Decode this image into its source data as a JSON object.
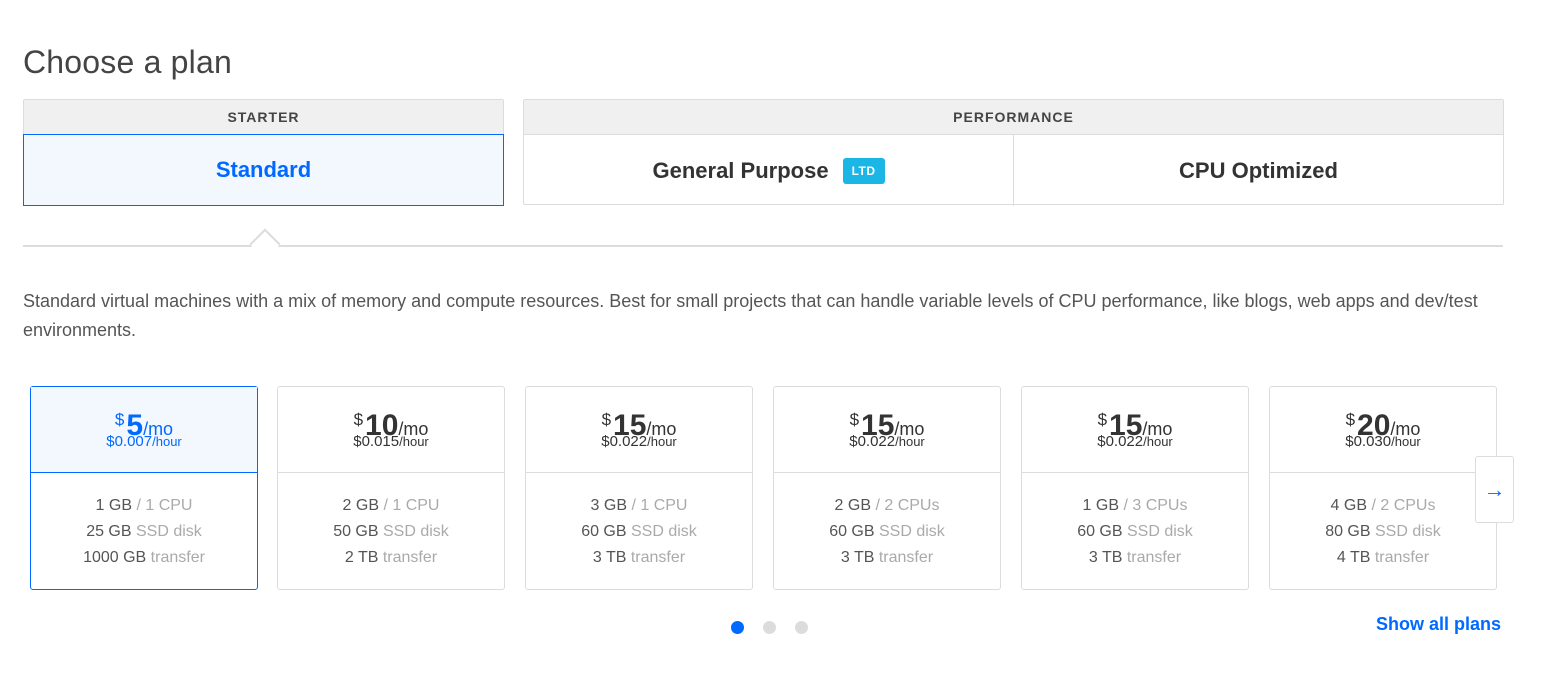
{
  "page_title": "Choose a plan",
  "categories": {
    "starter": {
      "header": "STARTER",
      "tabs": [
        {
          "label": "Standard",
          "selected": true
        }
      ]
    },
    "performance": {
      "header": "PERFORMANCE",
      "tabs": [
        {
          "label": "General Purpose",
          "badge": "LTD",
          "selected": false
        },
        {
          "label": "CPU Optimized",
          "selected": false
        }
      ]
    }
  },
  "description": "Standard virtual machines with a mix of memory and compute resources. Best for small projects that can handle variable levels of CPU performance, like blogs, web apps and dev/test environments.",
  "currency_symbol": "$",
  "per_month": "/mo",
  "per_hour": "/hour",
  "plans": [
    {
      "price": "5",
      "hourly": "$0.007",
      "memory": "1 GB",
      "cpu": "/ 1 CPU",
      "disk": "25 GB",
      "disk_label": "SSD disk",
      "transfer": "1000 GB",
      "transfer_label": "transfer",
      "selected": true
    },
    {
      "price": "10",
      "hourly": "$0.015",
      "memory": "2 GB",
      "cpu": "/ 1 CPU",
      "disk": "50 GB",
      "disk_label": "SSD disk",
      "transfer": "2 TB",
      "transfer_label": "transfer",
      "selected": false
    },
    {
      "price": "15",
      "hourly": "$0.022",
      "memory": "3 GB",
      "cpu": "/ 1 CPU",
      "disk": "60 GB",
      "disk_label": "SSD disk",
      "transfer": "3 TB",
      "transfer_label": "transfer",
      "selected": false
    },
    {
      "price": "15",
      "hourly": "$0.022",
      "memory": "2 GB",
      "cpu": "/ 2 CPUs",
      "disk": "60 GB",
      "disk_label": "SSD disk",
      "transfer": "3 TB",
      "transfer_label": "transfer",
      "selected": false
    },
    {
      "price": "15",
      "hourly": "$0.022",
      "memory": "1 GB",
      "cpu": "/ 3 CPUs",
      "disk": "60 GB",
      "disk_label": "SSD disk",
      "transfer": "3 TB",
      "transfer_label": "transfer",
      "selected": false
    },
    {
      "price": "20",
      "hourly": "$0.030",
      "memory": "4 GB",
      "cpu": "/ 2 CPUs",
      "disk": "80 GB",
      "disk_label": "SSD disk",
      "transfer": "4 TB",
      "transfer_label": "transfer",
      "selected": false
    }
  ],
  "next_icon": "arrow-right-icon",
  "pagination": {
    "pages": 3,
    "active": 0
  },
  "show_all_label": "Show all plans",
  "colors": {
    "accent": "#0069ff",
    "badge": "#1bb5e6",
    "border": "#dcdcdc"
  }
}
